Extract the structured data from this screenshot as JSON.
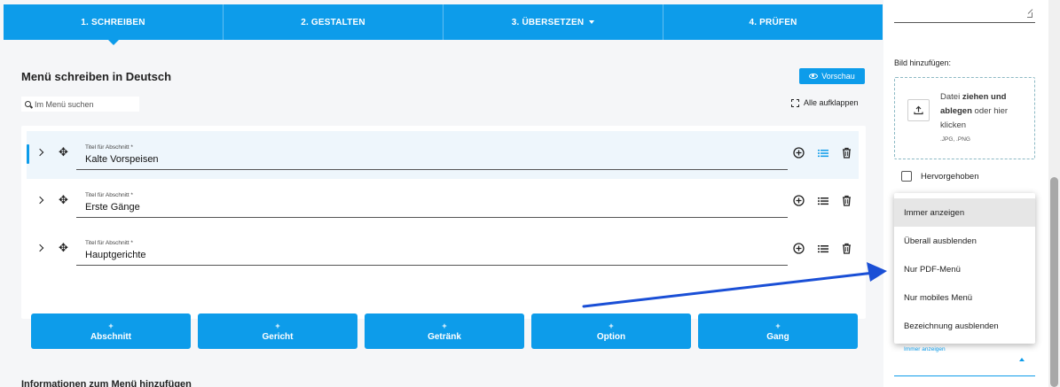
{
  "steps": [
    {
      "label": "1. SCHREIBEN",
      "active": true
    },
    {
      "label": "2. GESTALTEN",
      "active": false
    },
    {
      "label": "3. ÜBERSETZEN",
      "active": false,
      "has_dropdown": true
    },
    {
      "label": "4. PRÜFEN",
      "active": false
    }
  ],
  "main": {
    "title": "Menü schreiben in Deutsch",
    "preview_label": "Vorschau",
    "search_placeholder": "Im Menü suchen",
    "expand_all_label": "Alle aufklappen",
    "sections": [
      {
        "field_label": "Titel für Abschnitt *",
        "value": "Kalte Vorspeisen",
        "active": true
      },
      {
        "field_label": "Titel für Abschnitt *",
        "value": "Erste Gänge",
        "active": false
      },
      {
        "field_label": "Titel für Abschnitt *",
        "value": "Hauptgerichte",
        "active": false
      }
    ],
    "add_buttons": [
      {
        "plus": "+",
        "label": "Abschnitt"
      },
      {
        "plus": "+",
        "label": "Gericht"
      },
      {
        "plus": "+",
        "label": "Getränk"
      },
      {
        "plus": "+",
        "label": "Option"
      },
      {
        "plus": "+",
        "label": "Gang"
      }
    ],
    "info_title": "Informationen zum Menü hinzufügen"
  },
  "sidebar": {
    "image_label": "Bild hinzufügen:",
    "drop_text_pre": "Datei ",
    "drop_text_bold": "ziehen und ablegen",
    "drop_text_post": " oder hier klicken",
    "formats": ".JPG, .PNG",
    "featured_label": "Hervorgehoben",
    "dropdown_options": [
      "Immer anzeigen",
      "Überall ausblenden",
      "Nur PDF-Menü",
      "Nur mobiles Menü",
      "Bezeichnung ausblenden"
    ],
    "selected_option": "Immer anzeigen",
    "select_label": "Immer anzeigen"
  },
  "colors": {
    "accent": "#0d9cea",
    "annotation_arrow": "#1a4fd6"
  }
}
